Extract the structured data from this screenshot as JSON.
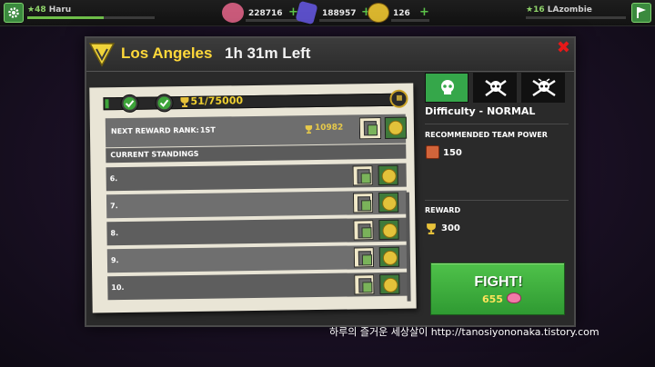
{
  "player": {
    "level": "48",
    "name": "Haru",
    "xp_progress": 0.6
  },
  "resources": [
    {
      "name": "brains",
      "value": "228716",
      "icon": "brain-icon",
      "color": "#d86a86"
    },
    {
      "name": "gems",
      "value": "188957",
      "icon": "gem-icon",
      "color": "#6a5ad8"
    },
    {
      "name": "coins",
      "value": "126",
      "icon": "coin-icon",
      "color": "#d9b52e"
    }
  ],
  "opponent": {
    "level": "16",
    "name": "LAzombie"
  },
  "event": {
    "city": "Los Angeles",
    "time_left": "1h 31m Left",
    "progress_text": "51/75000",
    "progress_fraction": 0.00068,
    "tier": "III"
  },
  "next_reward": {
    "label": "NEXT REWARD RANK:",
    "rank": "1ST",
    "points": "10982"
  },
  "standings": {
    "header": "CURRENT STANDINGS",
    "rows": [
      "6.",
      "7.",
      "8.",
      "9.",
      "10."
    ]
  },
  "difficulty": {
    "label": "Difficulty - NORMAL"
  },
  "recommended": {
    "label": "RECOMMENDED TEAM POWER",
    "value": "150"
  },
  "reward": {
    "label": "REWARD",
    "value": "300"
  },
  "fight": {
    "label": "FIGHT!",
    "cost": "655"
  },
  "watermark": "하루의 즐거운 세상살이 http://tanosiyononaka.tistory.com",
  "colors": {
    "accent_green": "#35a74a",
    "title_yellow": "#ffd83a",
    "close_red": "#e81818"
  }
}
